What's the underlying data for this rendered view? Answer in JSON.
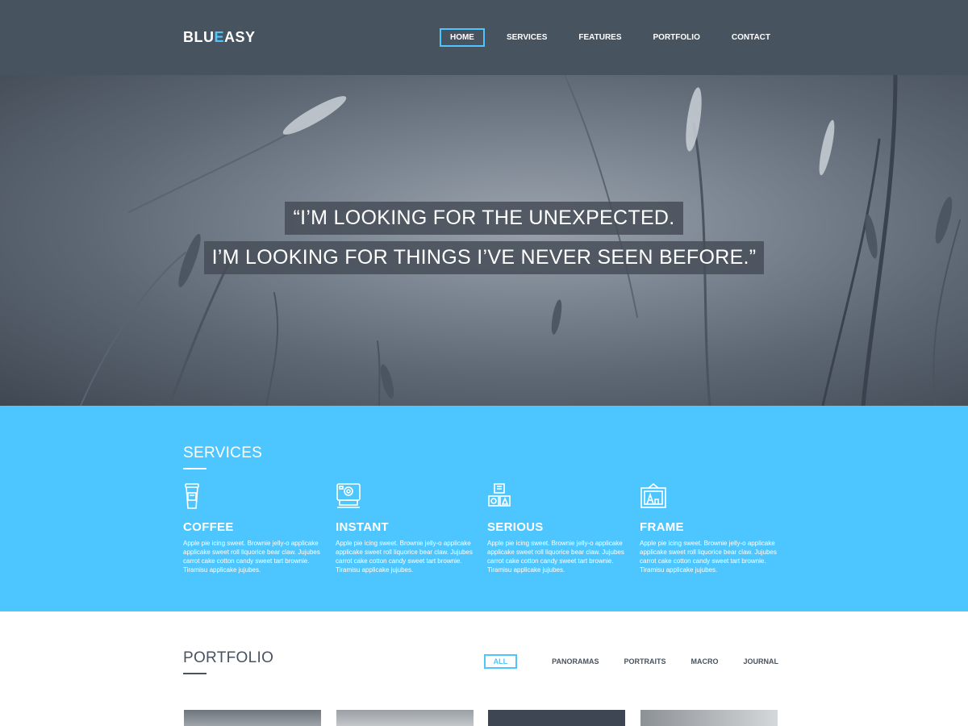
{
  "header": {
    "logo_part1": "BLU",
    "logo_part2": "E",
    "logo_part3": "ASY",
    "nav": [
      {
        "label": "HOME",
        "active": true
      },
      {
        "label": "SERVICES",
        "active": false
      },
      {
        "label": "FEATURES",
        "active": false
      },
      {
        "label": "PORTFOLIO",
        "active": false
      },
      {
        "label": "CONTACT",
        "active": false
      }
    ]
  },
  "hero": {
    "quote_line1": "“I’M LOOKING FOR THE UNEXPECTED.",
    "quote_line2": "I’M LOOKING FOR THINGS I’VE NEVER SEEN BEFORE.”"
  },
  "services": {
    "title": "SERVICES",
    "items": [
      {
        "icon": "coffee-cup-icon",
        "title": "COFFEE",
        "text": "Apple pie icing sweet. Brownie jelly-o applicake applicake sweet roll liquorice bear claw. Jujubes carrot cake cotton candy sweet tart brownie. Tiramisu applicake jujubes."
      },
      {
        "icon": "instant-camera-icon",
        "title": "INSTANT",
        "text": "Apple pie icing sweet. Brownie jelly-o applicake applicake sweet roll liquorice bear claw. Jujubes carrot cake cotton candy sweet tart brownie. Tiramisu applicake jujubes."
      },
      {
        "icon": "toy-blocks-icon",
        "title": "SERIOUS",
        "text": "Apple pie icing sweet. Brownie jelly-o applicake applicake sweet roll liquorice bear claw. Jujubes carrot cake cotton candy sweet tart brownie. Tiramisu applicake jujubes."
      },
      {
        "icon": "picture-frame-icon",
        "title": "FRAME",
        "text": "Apple pie icing sweet. Brownie jelly-o applicake applicake sweet roll liquorice bear claw. Jujubes carrot cake cotton candy sweet tart brownie. Tiramisu applicake jujubes."
      }
    ]
  },
  "portfolio": {
    "title": "PORTFOLIO",
    "filters": [
      {
        "label": "ALL",
        "active": true
      },
      {
        "label": "PANORAMAS",
        "active": false
      },
      {
        "label": "PORTRAITS",
        "active": false
      },
      {
        "label": "MACRO",
        "active": false
      },
      {
        "label": "JOURNAL",
        "active": false
      }
    ]
  },
  "colors": {
    "accent": "#4dc6ff",
    "header_bg": "#485360",
    "dark_text": "#485360"
  }
}
